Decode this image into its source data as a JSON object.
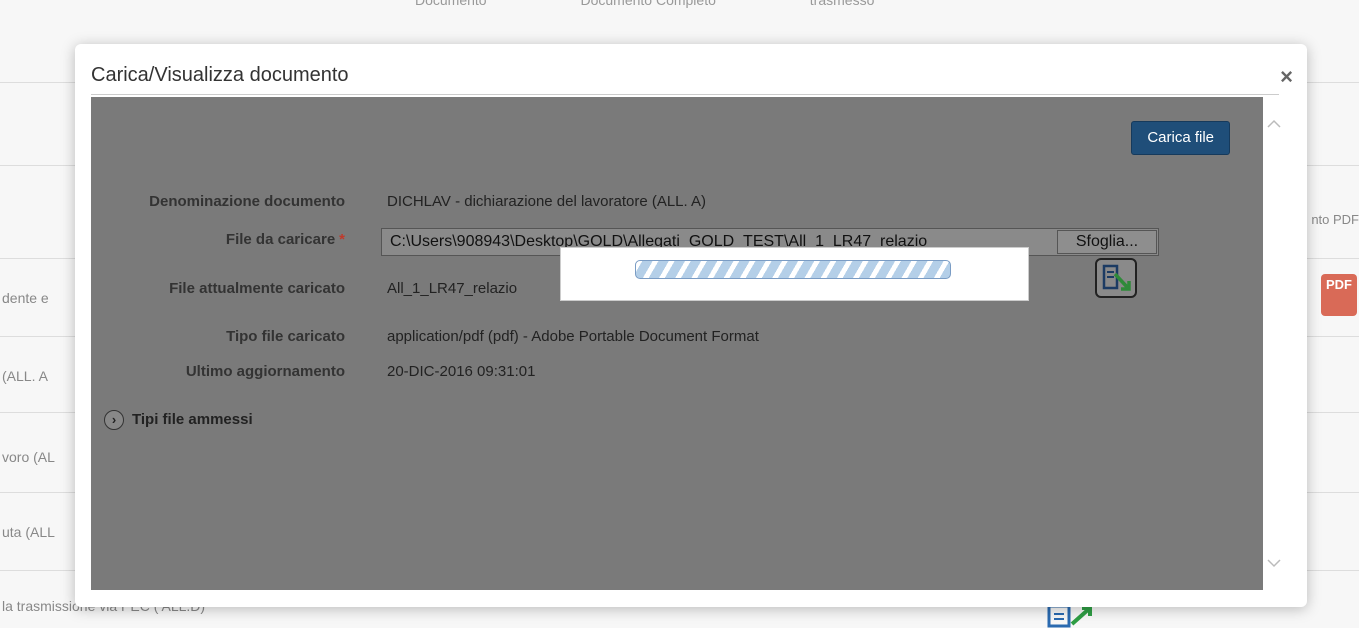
{
  "background": {
    "top_headers": [
      "Documento",
      "Documento Completo",
      "trasmesso"
    ],
    "right_header": "nto PDF",
    "rows": [
      "dente e",
      "(ALL. A",
      "voro (AL",
      "uta (ALL",
      "la trasmissione via PEC ( ALL.D)"
    ],
    "pdf_icon_label": "PDF"
  },
  "modal": {
    "title": "Carica/Visualizza documento",
    "close_label": "×",
    "upload_button": "Carica file",
    "fields": {
      "denominazione_label": "Denominazione documento",
      "denominazione_value": "DICHLAV - dichiarazione del lavoratore (ALL. A)",
      "file_label": "File da caricare",
      "required_mark": "*",
      "file_value": "C:\\Users\\908943\\Desktop\\GOLD\\Allegati_GOLD_TEST\\All_1_LR47_relazio",
      "browse_label": "Sfoglia...",
      "current_label": "File attualmente caricato",
      "current_value": "All_1_LR47_relazio",
      "type_label": "Tipo file caricato",
      "type_value": "application/pdf (pdf) - Adobe Portable Document Format",
      "updated_label": "Ultimo aggiornamento",
      "updated_value": "20-DIC-2016 09:31:01"
    },
    "allowed_types_label": "Tipi file ammessi",
    "icons": {
      "upload": "file-upload-icon",
      "close": "close-icon",
      "scroll_up": "chevron-up-icon",
      "scroll_down": "chevron-down-icon",
      "expand": "chevron-right-icon"
    },
    "colors": {
      "overlay": "#7a7a7a",
      "primary_button": "#1f4e79",
      "required": "#c0392b"
    }
  }
}
